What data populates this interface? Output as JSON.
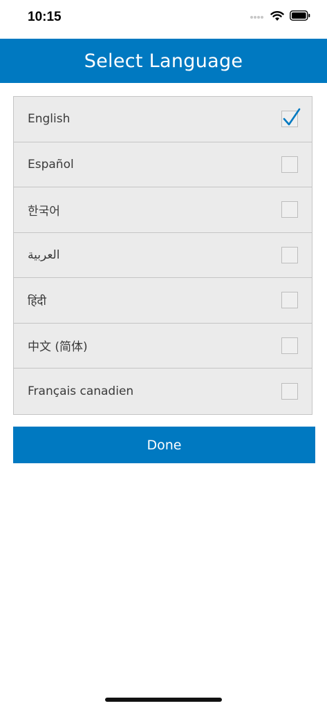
{
  "status_bar": {
    "time": "10:15"
  },
  "header": {
    "title": "Select Language"
  },
  "languages": [
    {
      "label": "English",
      "checked": true
    },
    {
      "label": "Español",
      "checked": false
    },
    {
      "label": "한국어",
      "checked": false
    },
    {
      "label": "العربية",
      "checked": false
    },
    {
      "label": "हिंदी",
      "checked": false
    },
    {
      "label": "中文 (简体)",
      "checked": false
    },
    {
      "label": "Français canadien",
      "checked": false
    }
  ],
  "done_button": {
    "label": "Done"
  },
  "colors": {
    "accent": "#0079c1",
    "row_bg": "#ebebeb",
    "border": "#c4c4c4"
  },
  "icons": [
    "signal-icon",
    "wifi-icon",
    "battery-icon",
    "checkmark-icon"
  ]
}
